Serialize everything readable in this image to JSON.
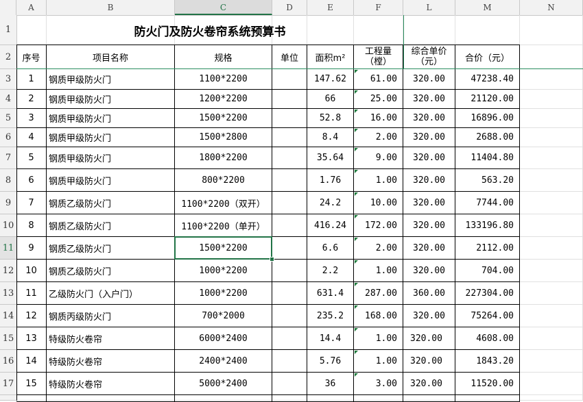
{
  "columns": [
    "A",
    "B",
    "C",
    "D",
    "E",
    "F",
    "L",
    "M",
    "N"
  ],
  "selected_column": "C",
  "selected_row": "11",
  "rows": [
    "1",
    "2",
    "3",
    "4",
    "5",
    "6",
    "7",
    "8",
    "9",
    "10",
    "11",
    "12",
    "13",
    "14",
    "15",
    "16",
    "17"
  ],
  "title": "防火门及防火卷帘系统预算书",
  "headers": {
    "seq": "序号",
    "name": "项目名称",
    "spec": "规格",
    "unit": "单位",
    "area": "面积m²",
    "qty_line1": "工程量",
    "qty_line2": "（樘）",
    "price_line1": "综合单价",
    "price_line2": "（元）",
    "total": "合价（元）"
  },
  "items": [
    {
      "seq": "1",
      "name": "钢质甲级防火门",
      "spec": "1100*2200",
      "unit": "",
      "area": "147.62",
      "qty": "61.00",
      "price": "320.00",
      "total": "47238.40"
    },
    {
      "seq": "2",
      "name": "钢质甲级防火门",
      "spec": "1200*2200",
      "unit": "",
      "area": "66",
      "qty": "25.00",
      "price": "320.00",
      "total": "21120.00"
    },
    {
      "seq": "3",
      "name": "钢质甲级防火门",
      "spec": "1500*2200",
      "unit": "",
      "area": "52.8",
      "qty": "16.00",
      "price": "320.00",
      "total": "16896.00"
    },
    {
      "seq": "4",
      "name": "钢质甲级防火门",
      "spec": "1500*2800",
      "unit": "",
      "area": "8.4",
      "qty": "2.00",
      "price": "320.00",
      "total": "2688.00"
    },
    {
      "seq": "5",
      "name": "钢质甲级防火门",
      "spec": "1800*2200",
      "unit": "",
      "area": "35.64",
      "qty": "9.00",
      "price": "320.00",
      "total": "11404.80"
    },
    {
      "seq": "6",
      "name": "钢质甲级防火门",
      "spec": "800*2200",
      "unit": "",
      "area": "1.76",
      "qty": "1.00",
      "price": "320.00",
      "total": "563.20"
    },
    {
      "seq": "7",
      "name": "钢质乙级防火门",
      "spec": "1100*2200（双开）",
      "unit": "",
      "area": "24.2",
      "qty": "10.00",
      "price": "320.00",
      "total": "7744.00"
    },
    {
      "seq": "8",
      "name": "钢质乙级防火门",
      "spec": "1100*2200（单开）",
      "unit": "",
      "area": "416.24",
      "qty": "172.00",
      "price": "320.00",
      "total": "133196.80"
    },
    {
      "seq": "9",
      "name": "钢质乙级防火门",
      "spec": "1500*2200",
      "unit": "",
      "area": "6.6",
      "qty": "2.00",
      "price": "320.00",
      "total": "2112.00"
    },
    {
      "seq": "10",
      "name": "钢质乙级防火门",
      "spec": "1000*2200",
      "unit": "",
      "area": "2.2",
      "qty": "1.00",
      "price": "320.00",
      "total": "704.00"
    },
    {
      "seq": "11",
      "name": "乙级防火门（入户门）",
      "spec": "1000*2200",
      "unit": "",
      "area": "631.4",
      "qty": "287.00",
      "price": "360.00",
      "total": "227304.00"
    },
    {
      "seq": "12",
      "name": "钢质丙级防火门",
      "spec": "700*2000",
      "unit": "",
      "area": "235.2",
      "qty": "168.00",
      "price": "320.00",
      "total": "75264.00"
    },
    {
      "seq": "13",
      "name": "特级防火卷帘",
      "spec": "6000*2400",
      "unit": "",
      "area": "14.4",
      "qty": "1.00",
      "price": "320.00",
      "total": "4608.00"
    },
    {
      "seq": "14",
      "name": "特级防火卷帘",
      "spec": "2400*2400",
      "unit": "",
      "area": "5.76",
      "qty": "1.00",
      "price": "320.00",
      "total": "1843.20"
    },
    {
      "seq": "15",
      "name": "特级防火卷帘",
      "spec": "5000*2400",
      "unit": "",
      "area": "36",
      "qty": "3.00",
      "price": "320.00",
      "total": "11520.00"
    }
  ],
  "colors": {
    "accent": "#217346",
    "freeze_line": "#2a8c5e",
    "comment_marker": "#1e7a3c"
  }
}
